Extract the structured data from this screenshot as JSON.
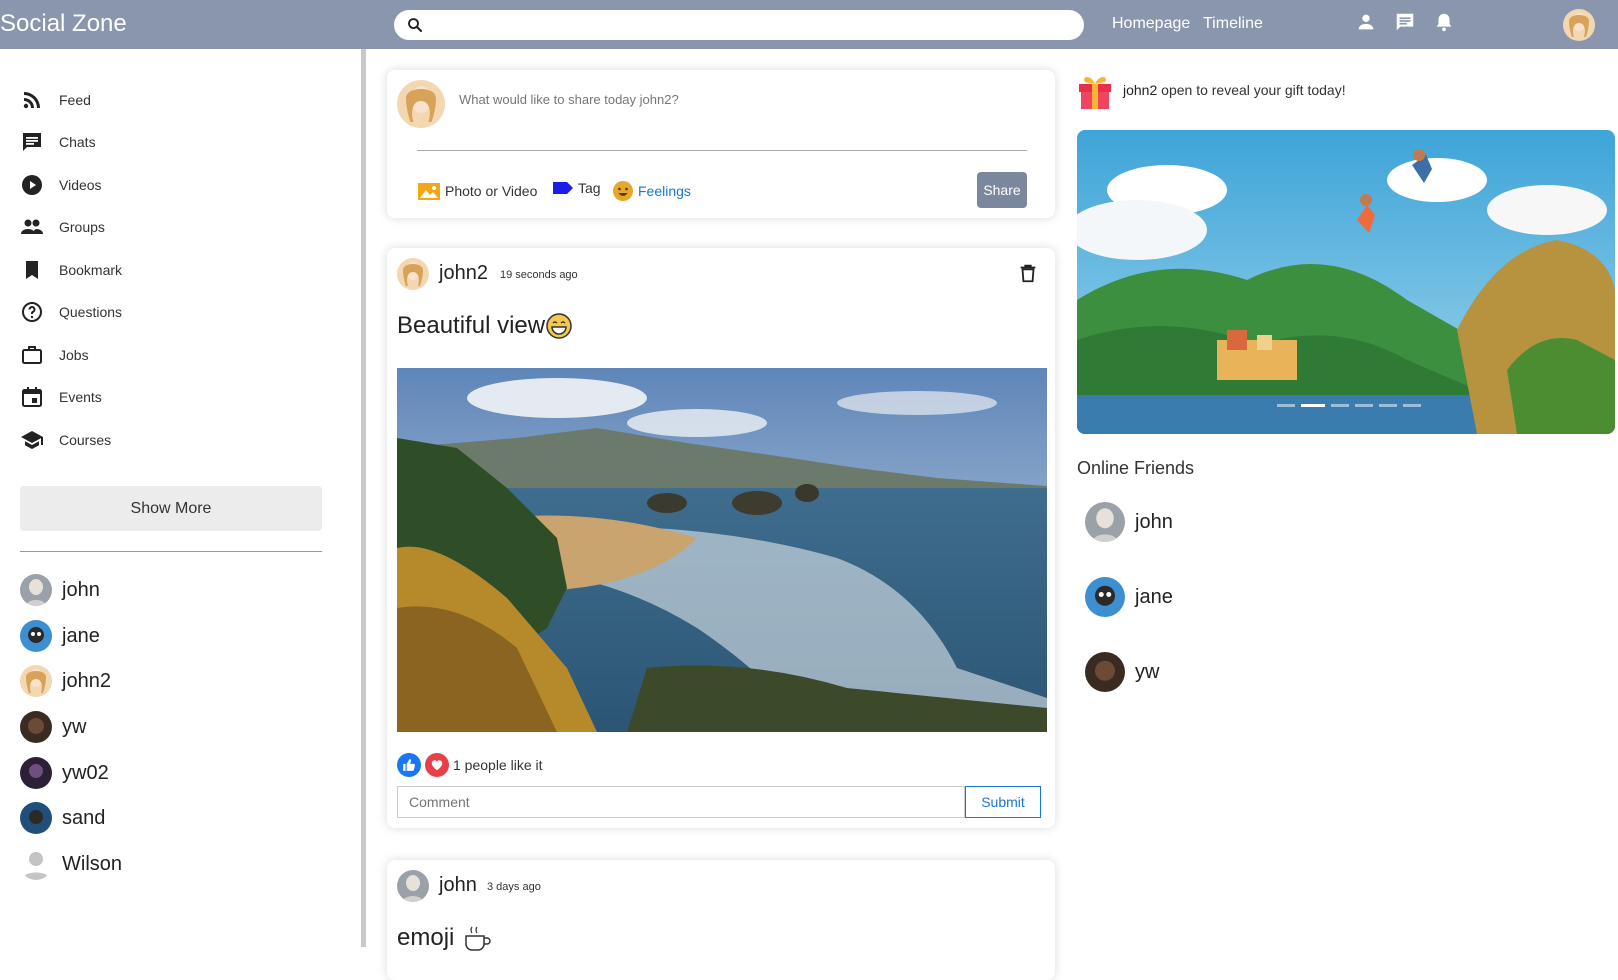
{
  "app": {
    "title": "Social Zone"
  },
  "search": {
    "placeholder": "",
    "value": ""
  },
  "nav": {
    "homepage": "Homepage",
    "timeline": "Timeline"
  },
  "sidebar": {
    "items": [
      {
        "label": "Feed",
        "icon": "rss-icon"
      },
      {
        "label": "Chats",
        "icon": "chat-icon"
      },
      {
        "label": "Videos",
        "icon": "play-circle-icon"
      },
      {
        "label": "Groups",
        "icon": "group-icon"
      },
      {
        "label": "Bookmark",
        "icon": "bookmark-icon"
      },
      {
        "label": "Questions",
        "icon": "help-icon"
      },
      {
        "label": "Jobs",
        "icon": "briefcase-icon"
      },
      {
        "label": "Events",
        "icon": "calendar-icon"
      },
      {
        "label": "Courses",
        "icon": "school-icon"
      }
    ],
    "show_more": "Show More",
    "friends": [
      "john",
      "jane",
      "john2",
      "yw",
      "yw02",
      "sand",
      "Wilson"
    ]
  },
  "share": {
    "placeholder": "What would like to share today john2?",
    "photo_video": "Photo or Video",
    "tag": "Tag",
    "feelings": "Feelings",
    "share_button": "Share"
  },
  "posts": [
    {
      "user": "john2",
      "time": "19 seconds ago",
      "text": "Beautiful view",
      "likes": "1 people like it",
      "comment_placeholder": "Comment",
      "submit": "Submit"
    },
    {
      "user": "john",
      "time": "3 days ago",
      "text": "emoji"
    }
  ],
  "gift": {
    "user": "john2",
    "text": " open to reveal your gift today!"
  },
  "online": {
    "title": "Online Friends",
    "friends": [
      "john",
      "jane",
      "yw"
    ]
  },
  "colors": {
    "topbar": "#8a96ae",
    "accent": "#1976d2",
    "share_button": "#7b879c"
  }
}
